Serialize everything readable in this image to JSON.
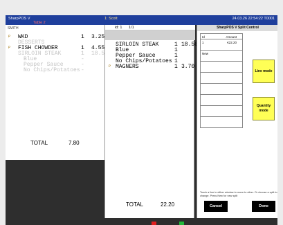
{
  "titlebar": {
    "app_name": "SharpPOS V",
    "table_name": "Table 2",
    "user": "1: Scott",
    "datetime": "24.03.26  22:54:22  T0001"
  },
  "left_panel": {
    "owner": "SMITH",
    "items": [
      {
        "marker": "P",
        "name": "WKD",
        "qty": "1",
        "price": "3.25",
        "style": "normal"
      },
      {
        "marker": "",
        "name": "DESSERTS",
        "qty": "",
        "price": "",
        "style": "void"
      },
      {
        "marker": "P",
        "name": "FISH CHOWDER",
        "qty": "1",
        "price": "4.55",
        "style": "normal"
      },
      {
        "marker": "",
        "name": "SIRLOIN STEAK",
        "qty": "1",
        "price": "18.50",
        "style": "void"
      },
      {
        "marker": "",
        "name": "Blue",
        "qty": "-",
        "price": "",
        "style": "void-sub"
      },
      {
        "marker": "",
        "name": "Pepper Sauce",
        "qty": "-",
        "price": "",
        "style": "void-sub"
      },
      {
        "marker": "",
        "name": "No Chips/Potatoes",
        "qty": "-",
        "price": "",
        "style": "void-sub"
      }
    ],
    "total_label": "TOTAL",
    "total_value": "7.80"
  },
  "mid_panel": {
    "header_id": "id: 1",
    "header_page": "1/1",
    "items": [
      {
        "marker": "",
        "name": "SIRLOIN STEAK",
        "qty": "1",
        "price": "18.50"
      },
      {
        "marker": "",
        "name": "Blue",
        "qty": "1",
        "price": ""
      },
      {
        "marker": "",
        "name": "Pepper Sauce",
        "qty": "1",
        "price": ""
      },
      {
        "marker": "",
        "name": "No Chips/Potatoes",
        "qty": "1",
        "price": ""
      },
      {
        "marker": "P",
        "name": "MAGNERS",
        "qty": "1",
        "price": "3.70"
      }
    ],
    "total_label": "TOTAL",
    "total_value": "22.20"
  },
  "dialog": {
    "title": "SharpPOS V Split Control",
    "col_id": "Id",
    "col_amount": "Amount",
    "rows": [
      {
        "id": "1",
        "amount": "€22.20"
      },
      {
        "id": "New",
        "amount": ""
      },
      {
        "id": "",
        "amount": ""
      },
      {
        "id": "",
        "amount": ""
      },
      {
        "id": "",
        "amount": ""
      },
      {
        "id": "",
        "amount": ""
      },
      {
        "id": "",
        "amount": ""
      },
      {
        "id": "",
        "amount": ""
      }
    ],
    "line_mode": "Line mode",
    "quantity_mode": "Quantity mode",
    "instructions": "Touch a line in either window to move to other. Or choose a split to change. Press New for new split",
    "cancel": "Cancel",
    "done": "Done"
  },
  "colors": {
    "titlebar": "#1f3f9c",
    "mode_button": "#ffff56",
    "void_text": "#c4c4c4"
  }
}
